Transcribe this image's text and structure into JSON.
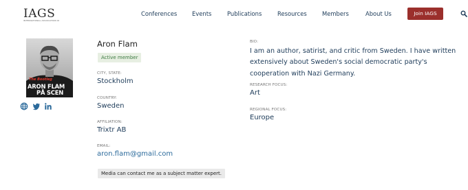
{
  "header": {
    "logo_text": "IAGS",
    "logo_subtitle": "International Association of Genocide Scholars",
    "nav": [
      "Conferences",
      "Events",
      "Publications",
      "Resources",
      "Members",
      "About Us"
    ],
    "join_label": "Join IAGS",
    "search_icon": "search-icon"
  },
  "profile": {
    "name": "Aron Flam",
    "status": "Active member",
    "photo": {
      "caption_small": "The Bootleg",
      "caption_line1": "ARON FLAM",
      "caption_line2": "PÅ SCEN"
    },
    "socials": [
      "globe-icon",
      "twitter-icon",
      "linkedin-icon"
    ],
    "city_label": "CITY, STATE:",
    "city": "Stockholm",
    "country_label": "COUNTRY:",
    "country": "Sweden",
    "affiliation_label": "AFFILIATION:",
    "affiliation": "Trixtr AB",
    "email_label": "EMAIL:",
    "email": "aron.flam@gmail.com",
    "media_note": "Media can contact me as a subject matter expert."
  },
  "details": {
    "bio_label": "BIO:",
    "bio": "I am an author, satirist, and critic from Sweden. I have written extensively about Sweden's social democratic party's cooperation with Nazi Germany.",
    "research_label": "RESEARCH FOCUS:",
    "research": "Art",
    "regional_label": "REGIONAL FOCUS:",
    "regional": "Europe"
  },
  "colors": {
    "accent": "#9b2f2c",
    "nav_text": "#1c3a58",
    "link": "#2b6a9b",
    "badge_bg": "#e7efe2",
    "badge_text": "#3c7a41"
  }
}
